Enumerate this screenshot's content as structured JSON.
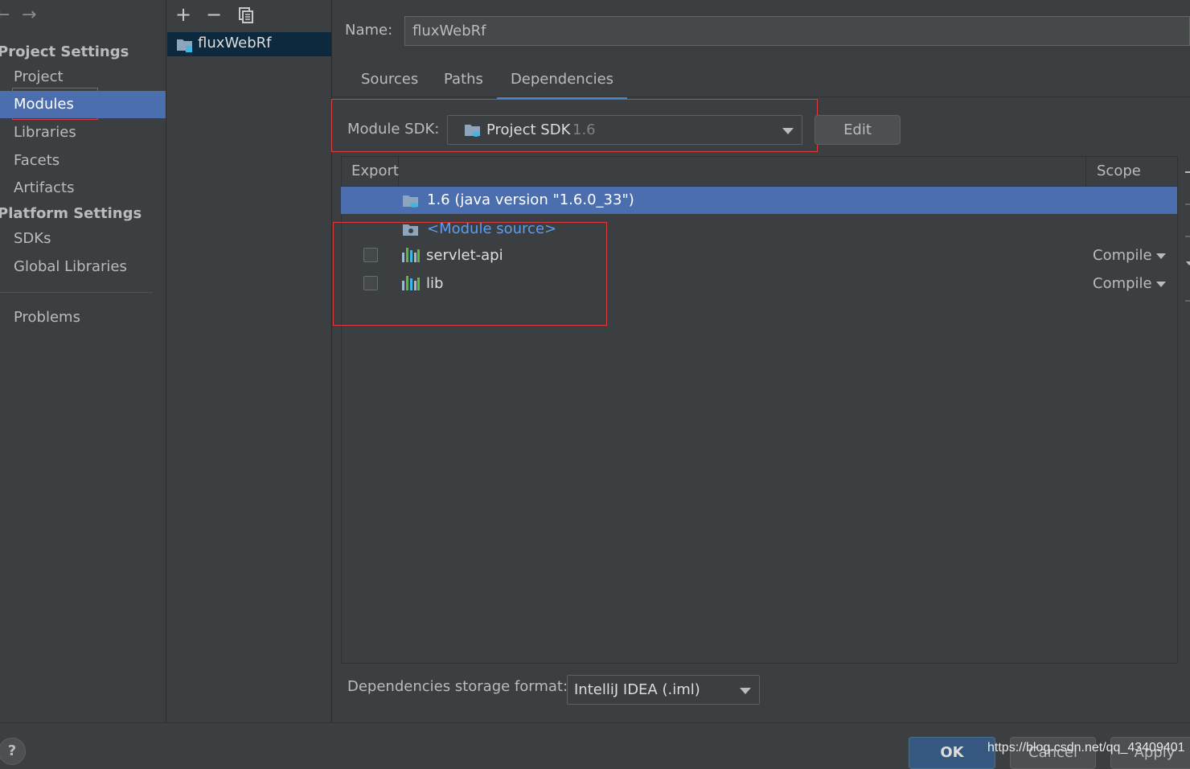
{
  "sidebar": {
    "back_arrow": "←",
    "forward_arrow": "→",
    "project_settings_title": "Project Settings",
    "project_items": [
      "Project",
      "Modules",
      "Libraries",
      "Facets",
      "Artifacts"
    ],
    "platform_settings_title": "Platform Settings",
    "platform_items": [
      "SDKs",
      "Global Libraries"
    ],
    "problems": "Problems",
    "selected_item": "Modules"
  },
  "module_list": {
    "add_icon": "+",
    "remove_icon": "−",
    "copy_icon": "copy-icon",
    "module_name": "fluxWebRf"
  },
  "main": {
    "name_label": "Name:",
    "name_value": "fluxWebRf",
    "tabs": [
      "Sources",
      "Paths",
      "Dependencies"
    ],
    "active_tab": "Dependencies",
    "module_sdk_label": "Module SDK:",
    "module_sdk_value": "Project SDK",
    "module_sdk_version": "1.6",
    "edit_button": "Edit",
    "table_headers": {
      "export": "Export",
      "scope": "Scope"
    },
    "dependencies": [
      {
        "name": "1.6 (java version \"1.6.0_33\")",
        "kind": "sdk",
        "selected": true
      },
      {
        "name": "<Module source>",
        "kind": "source"
      },
      {
        "name": "servlet-api",
        "kind": "library",
        "export": false,
        "scope": "Compile"
      },
      {
        "name": "lib",
        "kind": "library",
        "export": false,
        "scope": "Compile"
      }
    ],
    "storage_format_label": "Dependencies storage format:",
    "storage_format_value": "IntelliJ IDEA (.iml)"
  },
  "footer": {
    "help": "?",
    "ok": "OK",
    "cancel": "Cancel",
    "apply": "Apply",
    "watermark": "https://blog.csdn.net/qq_43409401"
  },
  "colors": {
    "background": "#3c3f41",
    "selection": "#4b6eaf",
    "highlight_box": "#e03a3a",
    "link": "#589df6"
  }
}
